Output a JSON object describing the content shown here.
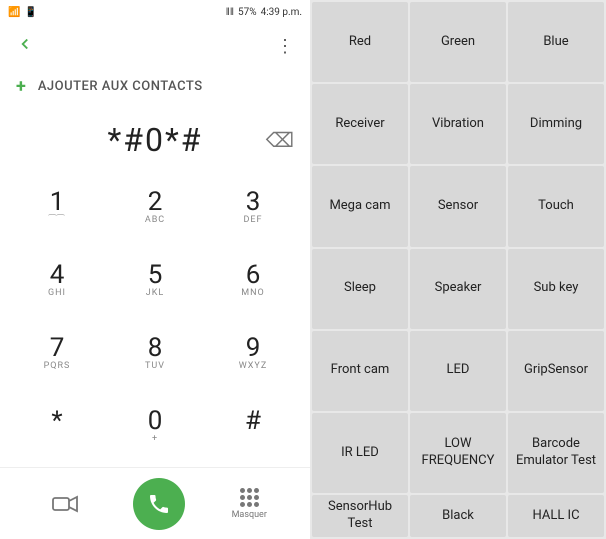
{
  "status_bar": {
    "left_icons": "📶",
    "signal_text": "57%",
    "time": "4:39 p.m."
  },
  "top_bar": {
    "back_arrow": "‹",
    "more_icon": "⋮"
  },
  "add_contact": {
    "plus": "+",
    "label": "AJOUTER AUX CONTACTS"
  },
  "dialer": {
    "display_number": "*#0*#",
    "backspace_icon": "⌫"
  },
  "keys": [
    {
      "main": "1",
      "sub": "     "
    },
    {
      "main": "2",
      "sub": "ABC"
    },
    {
      "main": "3",
      "sub": "DEF"
    },
    {
      "main": "4",
      "sub": "GHI"
    },
    {
      "main": "5",
      "sub": "JKL"
    },
    {
      "main": "6",
      "sub": "MNO"
    },
    {
      "main": "7",
      "sub": "PQRS"
    },
    {
      "main": "8",
      "sub": "TUV"
    },
    {
      "main": "9",
      "sub": "WXYZ"
    },
    {
      "main": "*",
      "sub": ""
    },
    {
      "main": "0",
      "sub": "+"
    },
    {
      "main": "#",
      "sub": ""
    }
  ],
  "bottom_bar": {
    "video_icon": "📹",
    "masquer_label": "Masquer"
  },
  "test_grid": {
    "buttons": [
      "Red",
      "Green",
      "Blue",
      "Receiver",
      "Vibration",
      "Dimming",
      "Mega cam",
      "Sensor",
      "Touch",
      "Sleep",
      "Speaker",
      "Sub key",
      "Front cam",
      "LED",
      "GripSensor",
      "IR LED",
      "LOW\nFREQUENCY",
      "Barcode\nEmulator\nTest",
      "SensorHub\nTest",
      "Black",
      "HALL IC"
    ]
  }
}
